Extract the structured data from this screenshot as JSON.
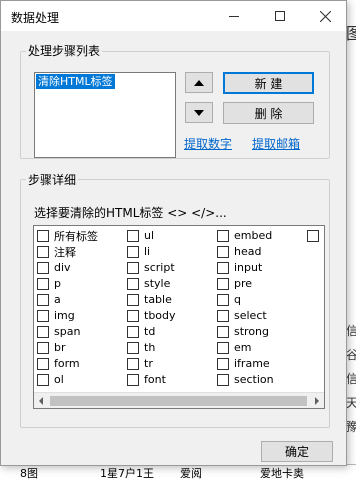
{
  "dialog": {
    "title": "数据处理",
    "steps_group_label": "处理步骤列表",
    "steps": [
      "清除HTML标签"
    ],
    "new_label": "新 建",
    "delete_label": "删 除",
    "extract_numbers_label": "提取数字",
    "extract_email_label": "提取邮箱",
    "detail_group_label": "步骤详细",
    "instruction": "选择要清除的HTML标签 <> </>...",
    "ok_label": "确定"
  },
  "tags": [
    [
      "所有标签",
      "ul",
      "embed"
    ],
    [
      "注释",
      "li",
      "head"
    ],
    [
      "div",
      "script",
      "input"
    ],
    [
      "p",
      "style",
      "pre"
    ],
    [
      "a",
      "table",
      "q"
    ],
    [
      "img",
      "tbody",
      "select"
    ],
    [
      "span",
      "td",
      "strong"
    ],
    [
      "br",
      "th",
      "em"
    ],
    [
      "form",
      "tr",
      "iframe"
    ],
    [
      "ol",
      "font",
      "section"
    ]
  ],
  "background": {
    "right_glyphs": [
      "图",
      "信",
      "谷",
      "信",
      "天",
      "豫"
    ],
    "bottom_texts": [
      "8图",
      "1星7户1王",
      "爱阅",
      "爱地卡奥"
    ]
  }
}
